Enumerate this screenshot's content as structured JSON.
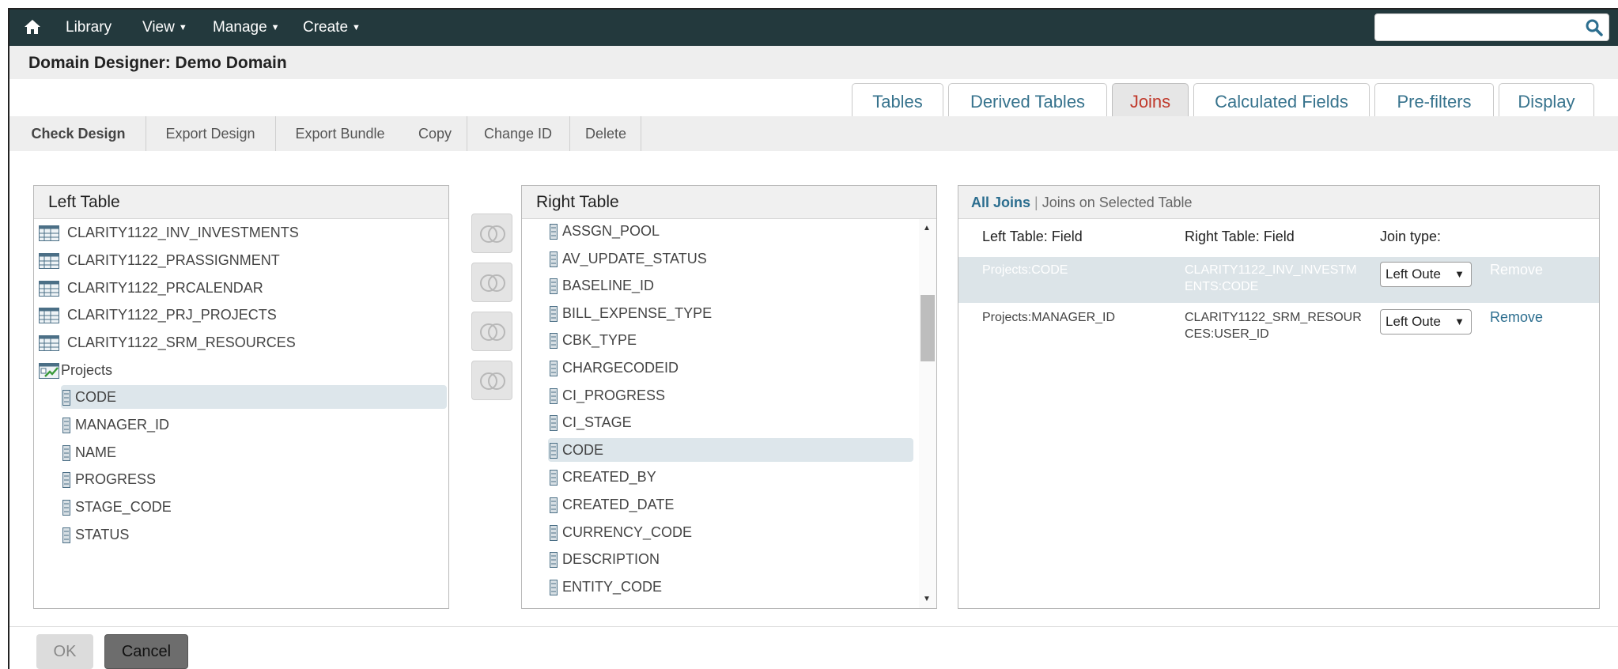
{
  "nav": {
    "items": [
      {
        "label": "Library",
        "has_caret": false
      },
      {
        "label": "View",
        "has_caret": true
      },
      {
        "label": "Manage",
        "has_caret": true
      },
      {
        "label": "Create",
        "has_caret": true
      }
    ],
    "search_value": ""
  },
  "page": {
    "title": "Domain Designer: Demo Domain"
  },
  "tabs": [
    {
      "label": "Tables",
      "active": false
    },
    {
      "label": "Derived Tables",
      "active": false
    },
    {
      "label": "Joins",
      "active": true
    },
    {
      "label": "Calculated Fields",
      "active": false
    },
    {
      "label": "Pre-filters",
      "active": false
    },
    {
      "label": "Display",
      "active": false
    }
  ],
  "toolbar": {
    "check_design": "Check Design",
    "export_design": "Export Design",
    "export_bundle": "Export Bundle",
    "copy": "Copy",
    "change_id": "Change ID",
    "delete": "Delete"
  },
  "left_table": {
    "title": "Left Table",
    "tables": [
      {
        "label": "CLARITY1122_INV_INVESTMENTS"
      },
      {
        "label": "CLARITY1122_PRASSIGNMENT"
      },
      {
        "label": "CLARITY1122_PRCALENDAR"
      },
      {
        "label": "CLARITY1122_PRJ_PROJECTS"
      },
      {
        "label": "CLARITY1122_SRM_RESOURCES"
      }
    ],
    "expanded": {
      "label": "Projects",
      "fields": [
        {
          "label": "CODE",
          "selected": true
        },
        {
          "label": "MANAGER_ID",
          "selected": false
        },
        {
          "label": "NAME",
          "selected": false
        },
        {
          "label": "PROGRESS",
          "selected": false
        },
        {
          "label": "STAGE_CODE",
          "selected": false
        },
        {
          "label": "STATUS",
          "selected": false
        }
      ]
    }
  },
  "right_table": {
    "title": "Right Table",
    "fields": [
      {
        "label": "ASSGN_POOL",
        "selected": false
      },
      {
        "label": "AV_UPDATE_STATUS",
        "selected": false
      },
      {
        "label": "BASELINE_ID",
        "selected": false
      },
      {
        "label": "BILL_EXPENSE_TYPE",
        "selected": false
      },
      {
        "label": "CBK_TYPE",
        "selected": false
      },
      {
        "label": "CHARGECODEID",
        "selected": false
      },
      {
        "label": "CI_PROGRESS",
        "selected": false
      },
      {
        "label": "CI_STAGE",
        "selected": false
      },
      {
        "label": "CODE",
        "selected": true
      },
      {
        "label": "CREATED_BY",
        "selected": false
      },
      {
        "label": "CREATED_DATE",
        "selected": false
      },
      {
        "label": "CURRENCY_CODE",
        "selected": false
      },
      {
        "label": "DESCRIPTION",
        "selected": false
      },
      {
        "label": "ENTITY_CODE",
        "selected": false
      }
    ]
  },
  "joins": {
    "filter_all": "All Joins",
    "filter_selected": "Joins on Selected Table",
    "headers": {
      "left": "Left Table: Field",
      "right": "Right Table: Field",
      "type": "Join type:"
    },
    "rows": [
      {
        "left": "Projects:CODE",
        "right_line1": "CLARITY1122_INV_INVESTM",
        "right_line2": "ENTS:CODE",
        "type": "Left Oute",
        "remove": "Remove",
        "selected": true
      },
      {
        "left": "Projects:MANAGER_ID",
        "right_line1": "CLARITY1122_SRM_RESOUR",
        "right_line2": "CES:USER_ID",
        "type": "Left Oute",
        "remove": "Remove",
        "selected": false
      }
    ]
  },
  "footer": {
    "ok": "OK",
    "cancel": "Cancel"
  }
}
